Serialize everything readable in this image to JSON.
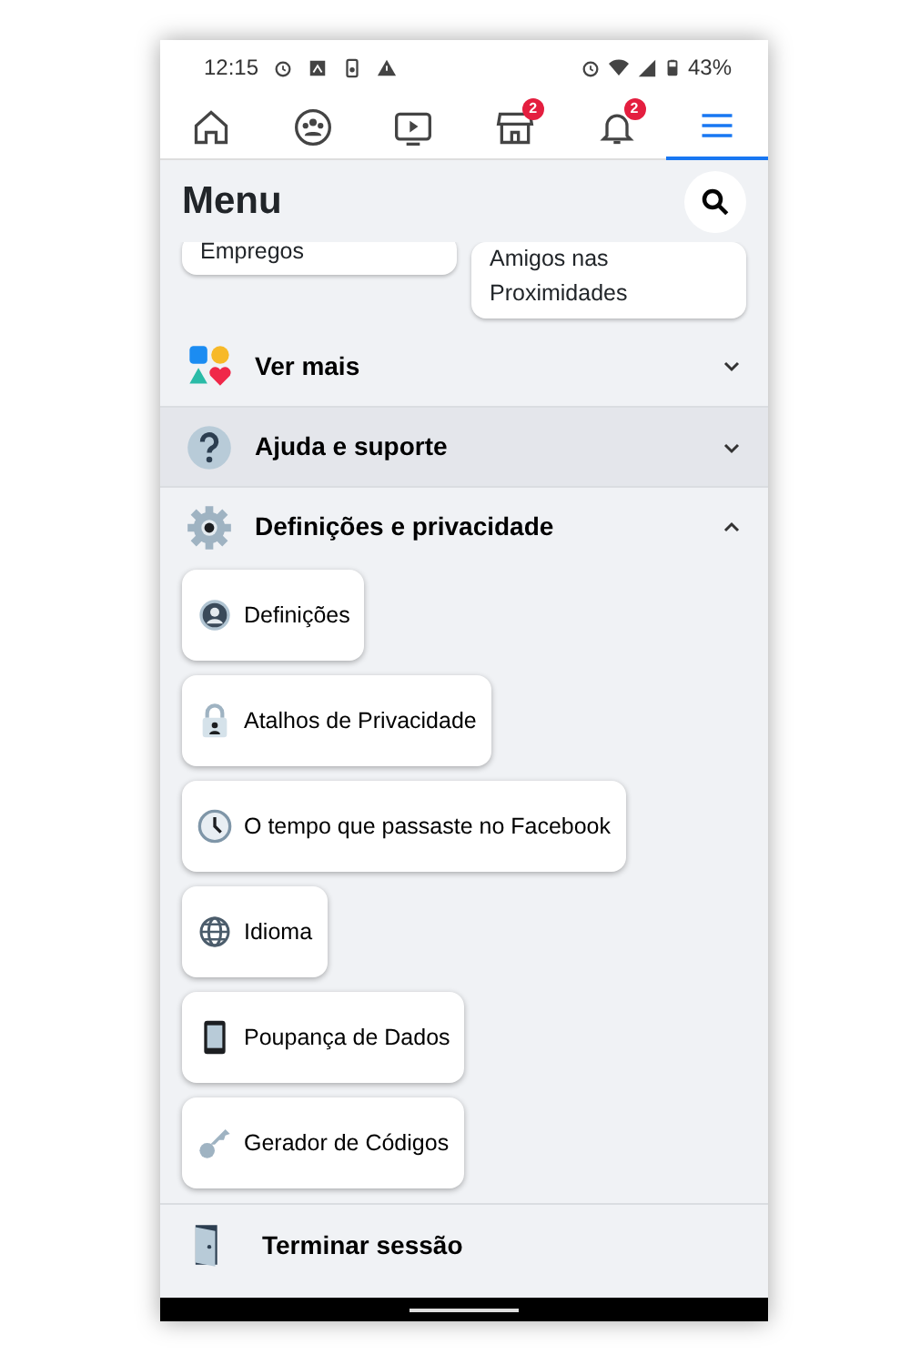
{
  "status_bar": {
    "time": "12:15",
    "battery": "43%"
  },
  "tabs": [
    {
      "kind": "home",
      "selected": false
    },
    {
      "kind": "groups",
      "selected": false
    },
    {
      "kind": "watch",
      "selected": false
    },
    {
      "kind": "marketplace",
      "selected": false,
      "badge": "2"
    },
    {
      "kind": "notifications",
      "selected": false,
      "badge": "2"
    },
    {
      "kind": "menu",
      "selected": true
    }
  ],
  "header": {
    "title": "Menu"
  },
  "shortcuts": [
    {
      "label": "Empregos"
    },
    {
      "label": "Amigos nas Proximidades"
    }
  ],
  "sections": [
    {
      "kind": "more",
      "label": "Ver mais",
      "expanded": false,
      "highlighted": false
    },
    {
      "kind": "help",
      "label": "Ajuda e suporte",
      "expanded": false,
      "highlighted": true
    },
    {
      "kind": "settings",
      "label": "Definições e privacidade",
      "expanded": true,
      "highlighted": false
    }
  ],
  "settings_items": [
    {
      "kind": "profile",
      "label": "Definições"
    },
    {
      "kind": "lock",
      "label": "Atalhos de Privacidade"
    },
    {
      "kind": "clock",
      "label": "O tempo que passaste no Facebook"
    },
    {
      "kind": "globe",
      "label": "Idioma"
    },
    {
      "kind": "phone",
      "label": "Poupança de Dados"
    },
    {
      "kind": "key",
      "label": "Gerador de Códigos"
    }
  ],
  "logout": {
    "label": "Terminar sessão"
  }
}
